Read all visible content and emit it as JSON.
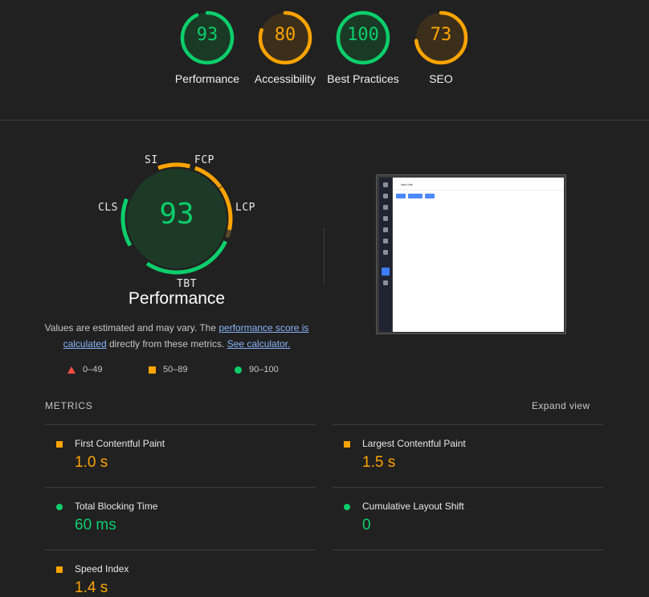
{
  "categories": [
    {
      "score": "93",
      "label": "Performance",
      "color": "#0cce6b"
    },
    {
      "score": "80",
      "label": "Accessibility",
      "color": "#ffa400"
    },
    {
      "score": "100",
      "label": "Best Practices",
      "color": "#0cce6b"
    },
    {
      "score": "73",
      "label": "SEO",
      "color": "#ffa400"
    }
  ],
  "performance": {
    "score": "93",
    "title": "Performance",
    "arc_labels": {
      "si": "SI",
      "fcp": "FCP",
      "lcp": "LCP",
      "tbt": "TBT",
      "cls": "CLS"
    }
  },
  "note": {
    "text1": "Values are estimated and may vary. The ",
    "link1": "performance score is calculated",
    "text2": " directly from these metrics. ",
    "link2": "See calculator."
  },
  "legend": {
    "fail": "0–49",
    "average": "50–89",
    "pass": "90–100"
  },
  "screenshot": {
    "tab_text": "load.vite"
  },
  "metrics": {
    "heading": "METRICS",
    "expand": "Expand view",
    "fcp": {
      "name": "First Contentful Paint",
      "value": "1.0 s",
      "status": "average"
    },
    "lcp": {
      "name": "Largest Contentful Paint",
      "value": "1.5 s",
      "status": "average"
    },
    "tbt": {
      "name": "Total Blocking Time",
      "value": "60 ms",
      "status": "pass"
    },
    "cls": {
      "name": "Cumulative Layout Shift",
      "value": "0",
      "status": "pass"
    },
    "si": {
      "name": "Speed Index",
      "value": "1.4 s",
      "status": "average"
    }
  },
  "colors": {
    "pass": "#0cce6b",
    "average": "#ffa400",
    "fail": "#ff4e42",
    "background": "#212121"
  }
}
